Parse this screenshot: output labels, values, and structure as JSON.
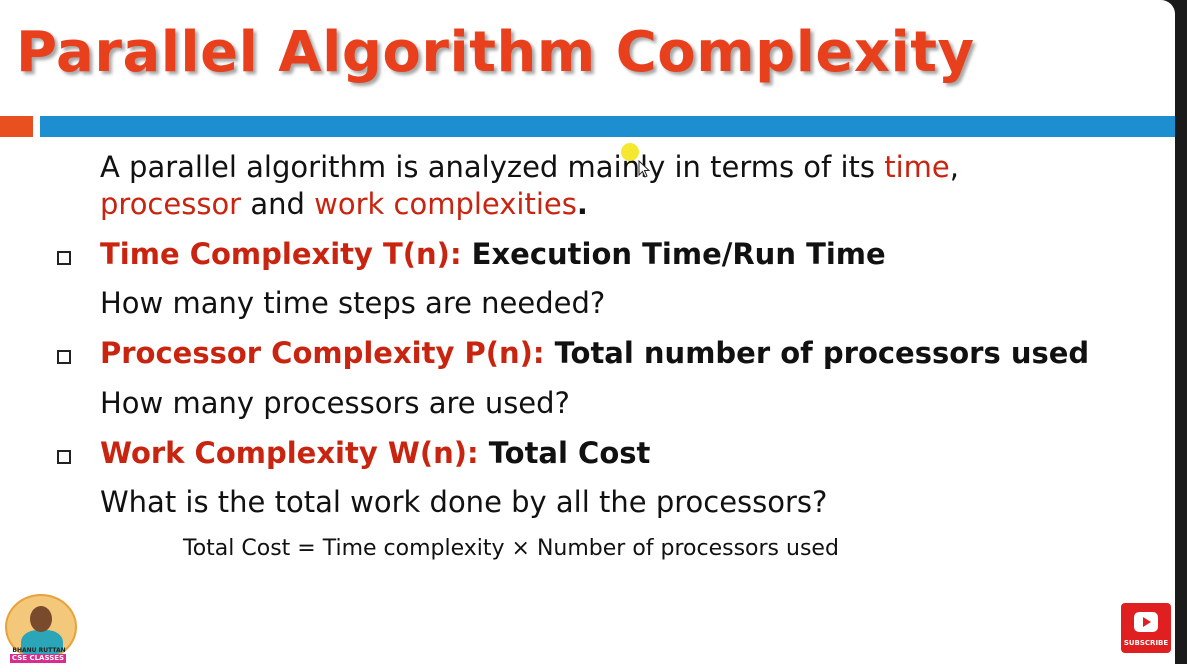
{
  "slide": {
    "title": "Parallel Algorithm Complexity",
    "intro": {
      "part1": "A parallel algorithm is analyzed mainly in terms of its ",
      "time": "time",
      "comma": ",",
      "processor": "processor",
      "and": " and ",
      "work": "work complexities",
      "period": "."
    },
    "items": [
      {
        "term": "Time Complexity T(n)",
        "colon": ": ",
        "definition": "Execution Time/Run Time",
        "question": "How many time steps are needed?"
      },
      {
        "term": "Processor Complexity P(n)",
        "colon": ": ",
        "definition": "Total number of processors used",
        "question": "How many processors are used?"
      },
      {
        "term": "Work Complexity W(n)",
        "colon": ": ",
        "definition": "Total Cost",
        "question": "What is the total work done by all the processors?"
      }
    ],
    "formula": "Total Cost = Time complexity × Number of processors used"
  },
  "overlay": {
    "channel_name": "BHANU RUTTAN",
    "channel_tag": "CSE CLASSES",
    "subscribe_label": "SUBSCRIBE"
  },
  "colors": {
    "title": "#e8401c",
    "highlight": "#c8240f",
    "accent_bar": "#1d8fd0",
    "accent_block": "#e8501f"
  },
  "icons": {
    "bullet": "hollow-square-icon",
    "pointer": "cursor-icon",
    "subscribe": "youtube-play-icon"
  }
}
